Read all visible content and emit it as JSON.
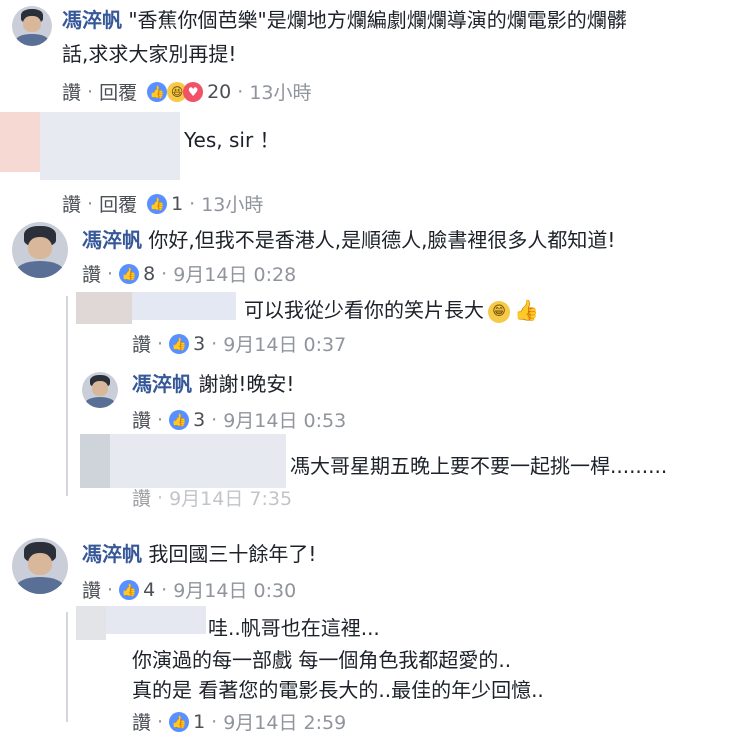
{
  "comments": [
    {
      "author": "馮淬帆",
      "text_line1": "\"香蕉你個芭樂\"是爛地方爛編劇爛爛導演的爛電影的爛髒",
      "text_line2": "話,求求大家別再提!",
      "like": "讚",
      "reply": "回覆",
      "count": "20",
      "time": "13小時"
    },
    {
      "author": "",
      "text": "Yes, sir ！",
      "like": "讚",
      "reply": "回覆",
      "count": "1",
      "time": "13小時"
    },
    {
      "author": "馮淬帆",
      "text": "你好,但我不是香港人,是順德人,臉書裡很多人都知道!",
      "like": "讚",
      "count": "8",
      "time": "9月14日 0:28"
    },
    {
      "author": "",
      "text": "可以我從少看你的笑片長大",
      "like": "讚",
      "count": "3",
      "time": "9月14日 0:37"
    },
    {
      "author": "馮淬帆",
      "text": "謝謝!晚安!",
      "like": "讚",
      "count": "3",
      "time": "9月14日 0:53"
    },
    {
      "author": "",
      "text": "馮大哥星期五晚上要不要一起挑一桿.........",
      "like": "讚",
      "time": "9月14日 7:35"
    },
    {
      "author": "馮淬帆",
      "text": "我回國三十餘年了!",
      "like": "讚",
      "count": "4",
      "time": "9月14日 0:30"
    },
    {
      "author": "",
      "text_line1": "哇..帆哥也在這裡...",
      "text_line2": "你演過的每一部戲 每一個角色我都超愛的..",
      "text_line3": "真的是 看著您的電影長大的..最佳的年少回憶..",
      "like": "讚",
      "count": "1",
      "time": "9月14日 2:59"
    }
  ],
  "colors": {
    "name": "#365899",
    "like_icon": "#5890ff",
    "meta": "#4b4f56"
  }
}
